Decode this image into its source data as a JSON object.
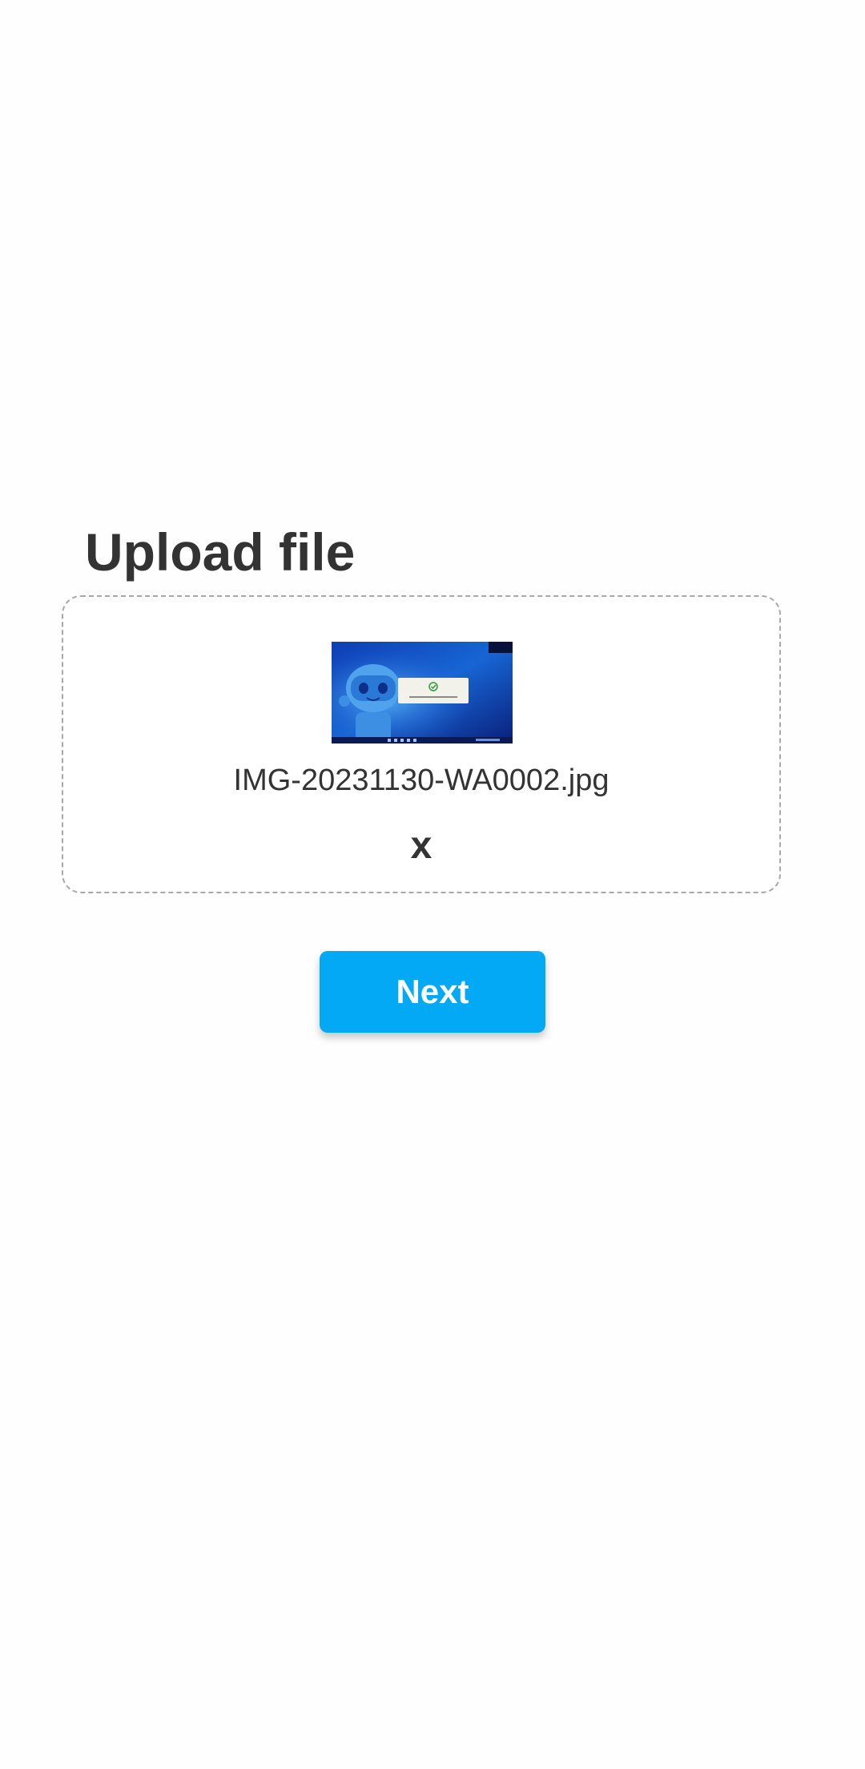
{
  "page": {
    "title": "Upload file"
  },
  "upload": {
    "file_name": "IMG-20231130-WA0002.jpg",
    "remove_label": "x",
    "thumbnail": "uploaded image preview: robot mascot on blue screen with success dialog"
  },
  "actions": {
    "next_label": "Next"
  },
  "colors": {
    "accent": "#03a9f4",
    "text": "#333333",
    "border": "#a8a8a8",
    "background": "#fefefe"
  }
}
